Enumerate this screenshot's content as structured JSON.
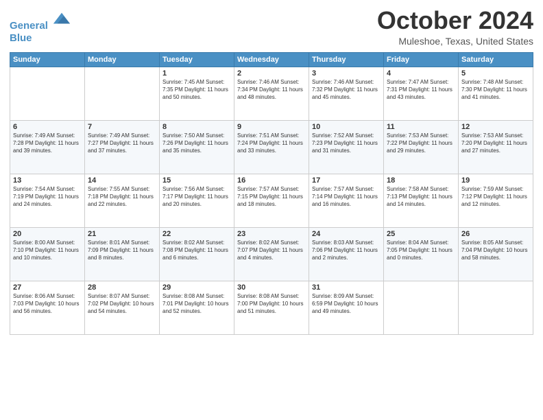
{
  "header": {
    "logo_line1": "General",
    "logo_line2": "Blue",
    "title": "October 2024",
    "subtitle": "Muleshoe, Texas, United States"
  },
  "weekdays": [
    "Sunday",
    "Monday",
    "Tuesday",
    "Wednesday",
    "Thursday",
    "Friday",
    "Saturday"
  ],
  "weeks": [
    [
      {
        "day": "",
        "info": ""
      },
      {
        "day": "",
        "info": ""
      },
      {
        "day": "1",
        "info": "Sunrise: 7:45 AM\nSunset: 7:35 PM\nDaylight: 11 hours and 50 minutes."
      },
      {
        "day": "2",
        "info": "Sunrise: 7:46 AM\nSunset: 7:34 PM\nDaylight: 11 hours and 48 minutes."
      },
      {
        "day": "3",
        "info": "Sunrise: 7:46 AM\nSunset: 7:32 PM\nDaylight: 11 hours and 45 minutes."
      },
      {
        "day": "4",
        "info": "Sunrise: 7:47 AM\nSunset: 7:31 PM\nDaylight: 11 hours and 43 minutes."
      },
      {
        "day": "5",
        "info": "Sunrise: 7:48 AM\nSunset: 7:30 PM\nDaylight: 11 hours and 41 minutes."
      }
    ],
    [
      {
        "day": "6",
        "info": "Sunrise: 7:49 AM\nSunset: 7:28 PM\nDaylight: 11 hours and 39 minutes."
      },
      {
        "day": "7",
        "info": "Sunrise: 7:49 AM\nSunset: 7:27 PM\nDaylight: 11 hours and 37 minutes."
      },
      {
        "day": "8",
        "info": "Sunrise: 7:50 AM\nSunset: 7:26 PM\nDaylight: 11 hours and 35 minutes."
      },
      {
        "day": "9",
        "info": "Sunrise: 7:51 AM\nSunset: 7:24 PM\nDaylight: 11 hours and 33 minutes."
      },
      {
        "day": "10",
        "info": "Sunrise: 7:52 AM\nSunset: 7:23 PM\nDaylight: 11 hours and 31 minutes."
      },
      {
        "day": "11",
        "info": "Sunrise: 7:53 AM\nSunset: 7:22 PM\nDaylight: 11 hours and 29 minutes."
      },
      {
        "day": "12",
        "info": "Sunrise: 7:53 AM\nSunset: 7:20 PM\nDaylight: 11 hours and 27 minutes."
      }
    ],
    [
      {
        "day": "13",
        "info": "Sunrise: 7:54 AM\nSunset: 7:19 PM\nDaylight: 11 hours and 24 minutes."
      },
      {
        "day": "14",
        "info": "Sunrise: 7:55 AM\nSunset: 7:18 PM\nDaylight: 11 hours and 22 minutes."
      },
      {
        "day": "15",
        "info": "Sunrise: 7:56 AM\nSunset: 7:17 PM\nDaylight: 11 hours and 20 minutes."
      },
      {
        "day": "16",
        "info": "Sunrise: 7:57 AM\nSunset: 7:15 PM\nDaylight: 11 hours and 18 minutes."
      },
      {
        "day": "17",
        "info": "Sunrise: 7:57 AM\nSunset: 7:14 PM\nDaylight: 11 hours and 16 minutes."
      },
      {
        "day": "18",
        "info": "Sunrise: 7:58 AM\nSunset: 7:13 PM\nDaylight: 11 hours and 14 minutes."
      },
      {
        "day": "19",
        "info": "Sunrise: 7:59 AM\nSunset: 7:12 PM\nDaylight: 11 hours and 12 minutes."
      }
    ],
    [
      {
        "day": "20",
        "info": "Sunrise: 8:00 AM\nSunset: 7:10 PM\nDaylight: 11 hours and 10 minutes."
      },
      {
        "day": "21",
        "info": "Sunrise: 8:01 AM\nSunset: 7:09 PM\nDaylight: 11 hours and 8 minutes."
      },
      {
        "day": "22",
        "info": "Sunrise: 8:02 AM\nSunset: 7:08 PM\nDaylight: 11 hours and 6 minutes."
      },
      {
        "day": "23",
        "info": "Sunrise: 8:02 AM\nSunset: 7:07 PM\nDaylight: 11 hours and 4 minutes."
      },
      {
        "day": "24",
        "info": "Sunrise: 8:03 AM\nSunset: 7:06 PM\nDaylight: 11 hours and 2 minutes."
      },
      {
        "day": "25",
        "info": "Sunrise: 8:04 AM\nSunset: 7:05 PM\nDaylight: 11 hours and 0 minutes."
      },
      {
        "day": "26",
        "info": "Sunrise: 8:05 AM\nSunset: 7:04 PM\nDaylight: 10 hours and 58 minutes."
      }
    ],
    [
      {
        "day": "27",
        "info": "Sunrise: 8:06 AM\nSunset: 7:03 PM\nDaylight: 10 hours and 56 minutes."
      },
      {
        "day": "28",
        "info": "Sunrise: 8:07 AM\nSunset: 7:02 PM\nDaylight: 10 hours and 54 minutes."
      },
      {
        "day": "29",
        "info": "Sunrise: 8:08 AM\nSunset: 7:01 PM\nDaylight: 10 hours and 52 minutes."
      },
      {
        "day": "30",
        "info": "Sunrise: 8:08 AM\nSunset: 7:00 PM\nDaylight: 10 hours and 51 minutes."
      },
      {
        "day": "31",
        "info": "Sunrise: 8:09 AM\nSunset: 6:59 PM\nDaylight: 10 hours and 49 minutes."
      },
      {
        "day": "",
        "info": ""
      },
      {
        "day": "",
        "info": ""
      }
    ]
  ]
}
